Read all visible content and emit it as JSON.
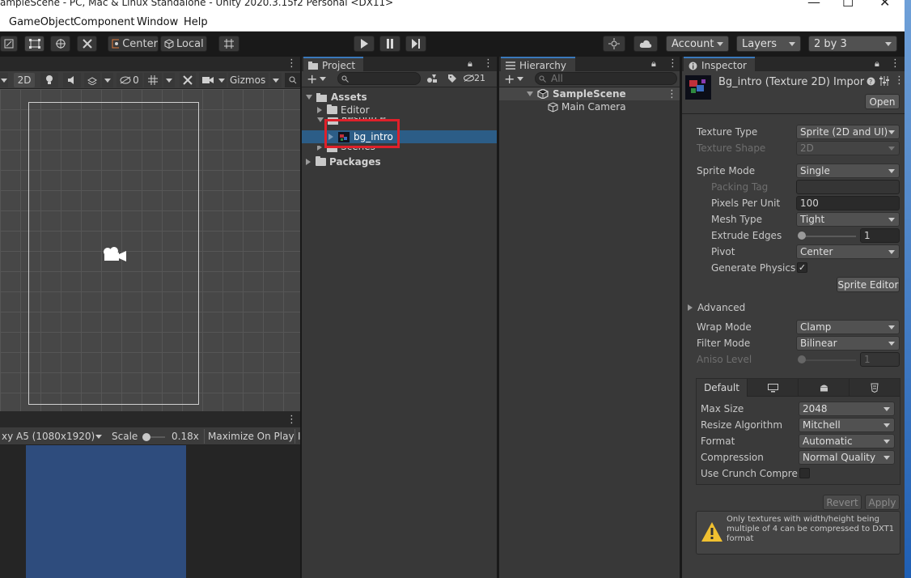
{
  "window": {
    "title": "ampleScene - PC, Mac & Linux Standalone - Unity 2020.3.15f2 Personal <DX11>",
    "controls": [
      "—",
      "☐",
      "✕"
    ]
  },
  "menubar": [
    "GameObject",
    "Component",
    "Window",
    "Help"
  ],
  "toolbar": {
    "pivot_label": "Center",
    "space_label": "Local",
    "account_label": "Account",
    "layers_label": "Layers",
    "layout_label": "2 by 3"
  },
  "scene": {
    "mode_2d": "2D",
    "hidden_count": "0",
    "gizmos_label": "Gizmos"
  },
  "game": {
    "resolution": "xy A5 (1080x1920)",
    "scale_label": "Scale",
    "scale_value": "0.18x",
    "maximize_label": "Maximize On Play"
  },
  "project": {
    "tab_label": "Project",
    "hidden_count": "21",
    "tree": {
      "assets": "Assets",
      "editor": "Editor",
      "resource": "Resource",
      "bg_intro": "bg_intro",
      "scenes": "Scenes",
      "packages": "Packages"
    }
  },
  "hierarchy": {
    "tab_label": "Hierarchy",
    "search_placeholder": "All",
    "scene": "SampleScene",
    "camera": "Main Camera"
  },
  "inspector": {
    "tab_label": "Inspector",
    "asset_title": "Bg_intro (Texture 2D) Impor",
    "open_label": "Open",
    "texture_type_label": "Texture Type",
    "texture_type_value": "Sprite (2D and UI)",
    "texture_shape_label": "Texture Shape",
    "texture_shape_value": "2D",
    "sprite_mode_label": "Sprite Mode",
    "sprite_mode_value": "Single",
    "packing_tag_label": "Packing Tag",
    "ppu_label": "Pixels Per Unit",
    "ppu_value": "100",
    "mesh_type_label": "Mesh Type",
    "mesh_type_value": "Tight",
    "extrude_label": "Extrude Edges",
    "extrude_value": "1",
    "pivot_label": "Pivot",
    "pivot_value": "Center",
    "gen_physics_label": "Generate Physics S",
    "sprite_editor_label": "Sprite Editor",
    "advanced_label": "Advanced",
    "wrap_label": "Wrap Mode",
    "wrap_value": "Clamp",
    "filter_label": "Filter Mode",
    "filter_value": "Bilinear",
    "aniso_label": "Aniso Level",
    "aniso_value": "1",
    "platform_default": "Default",
    "max_size_label": "Max Size",
    "max_size_value": "2048",
    "resize_label": "Resize Algorithm",
    "resize_value": "Mitchell",
    "format_label": "Format",
    "format_value": "Automatic",
    "compression_label": "Compression",
    "compression_value": "Normal Quality",
    "crunch_label": "Use Crunch Compres",
    "revert_label": "Revert",
    "apply_label": "Apply",
    "warning_text": "Only textures with width/height being multiple of 4 can be compressed to DXT1 format"
  },
  "colors": {
    "selection": "#2c5d87",
    "highlight_box": "#e0202a",
    "game_view": "#2e4c7d"
  }
}
